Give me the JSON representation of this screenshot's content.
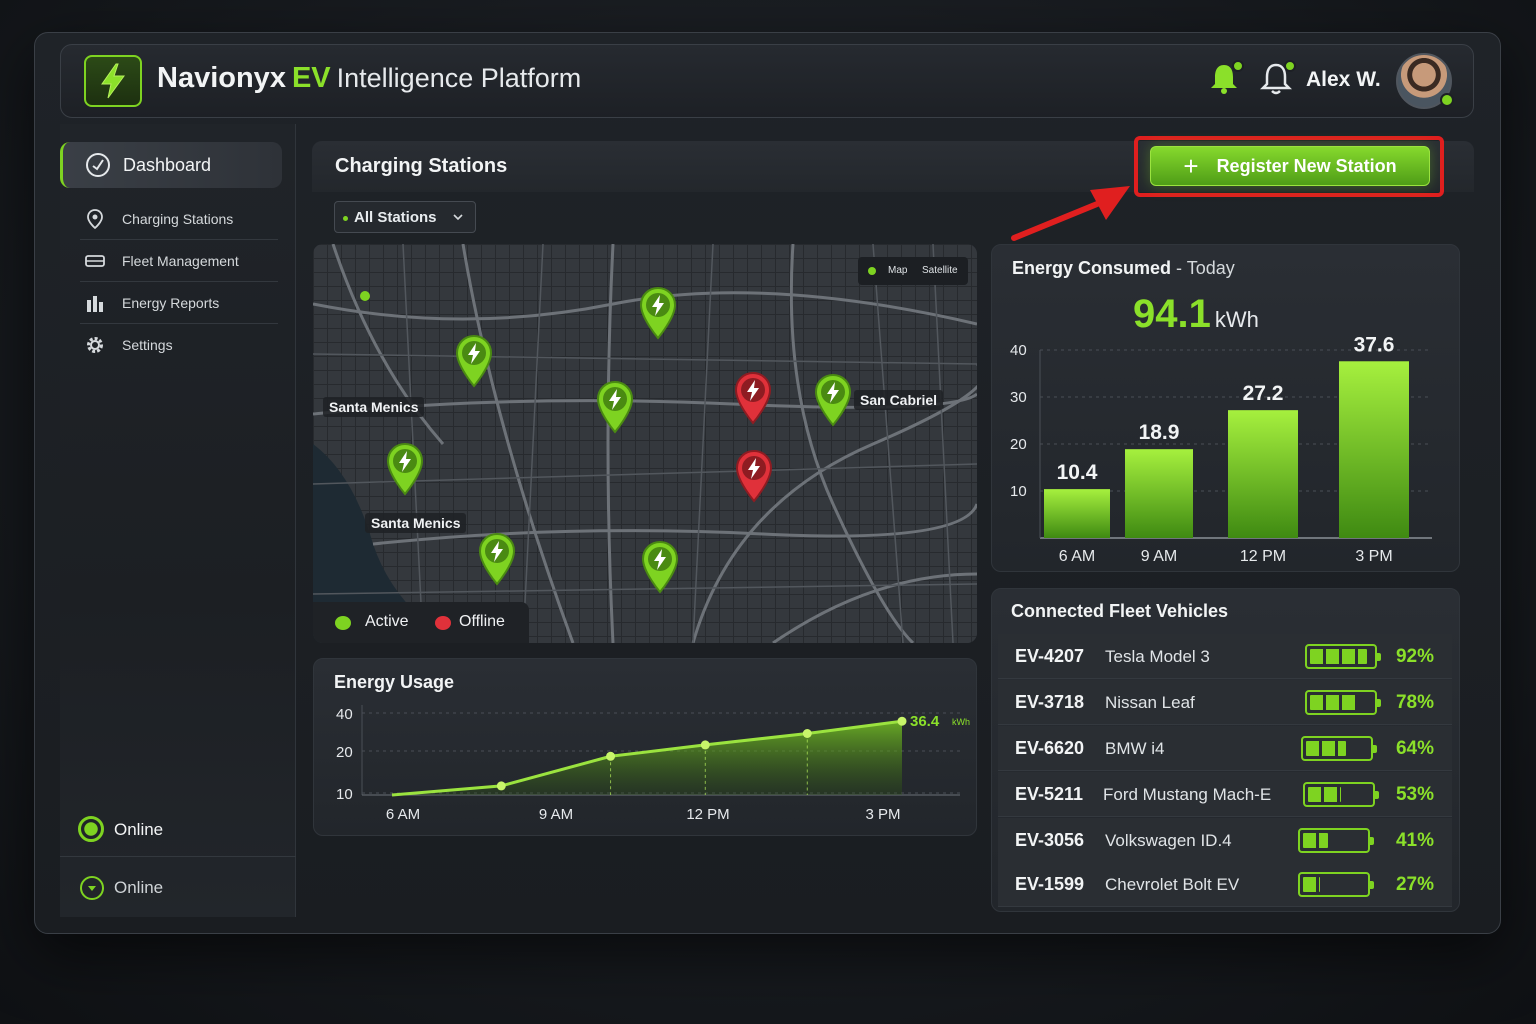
{
  "header": {
    "brand_name": "Navionyx",
    "brand_ev": "EV",
    "brand_suffix": "Intelligence Platform",
    "user_name": "Alex W."
  },
  "sidebar": {
    "items": [
      {
        "label": "Dashboard",
        "icon": "dashboard-icon",
        "active": true
      },
      {
        "label": "Charging Stations",
        "icon": "location-pin-icon"
      },
      {
        "label": "Fleet Management",
        "icon": "car-icon"
      },
      {
        "label": "Energy Reports",
        "icon": "bar-chart-icon"
      },
      {
        "label": "Settings",
        "icon": "gear-icon"
      }
    ],
    "status_primary": "Online",
    "status_secondary": "Online"
  },
  "main": {
    "title": "Charging Stations",
    "register_button": "Register New Station",
    "filter_value": "All Stations"
  },
  "map": {
    "toggle_map": "Map",
    "toggle_satellite": "Satellite",
    "labels": [
      "Santa Menics",
      "Santa Menics",
      "San Cabriel"
    ],
    "legend_active": "Active",
    "legend_offline": "Offline",
    "stations": {
      "active": 8,
      "offline": 2
    }
  },
  "energy_consumed": {
    "title": "Energy Consumed",
    "period": "- Today",
    "value": "94.1",
    "unit": "kWh"
  },
  "energy_usage": {
    "title": "Energy Usage",
    "end_label": "36.4",
    "end_unit": "kWh"
  },
  "fleet": {
    "title": "Connected Fleet Vehicles",
    "vehicles": [
      {
        "id": "EV-4207",
        "model": "Tesla Model 3",
        "charge": "92%",
        "level": 0.92
      },
      {
        "id": "EV-3718",
        "model": "Nissan Leaf",
        "charge": "78%",
        "level": 0.78
      },
      {
        "id": "EV-6620",
        "model": "BMW i4",
        "charge": "64%",
        "level": 0.64
      },
      {
        "id": "EV-5211",
        "model": "Ford Mustang Mach-E",
        "charge": "53%",
        "level": 0.53
      },
      {
        "id": "EV-3056",
        "model": "Volkswagen ID.4",
        "charge": "41%",
        "level": 0.41
      },
      {
        "id": "EV-1599",
        "model": "Chevrolet Bolt EV",
        "charge": "27%",
        "level": 0.27
      }
    ]
  },
  "colors": {
    "accent": "#7ed321",
    "alert": "#e01f1f",
    "offline": "#e0313a"
  },
  "chart_data": [
    {
      "type": "bar",
      "title": "Energy Consumed",
      "categories": [
        "6 AM",
        "9 AM",
        "12 PM",
        "3 PM"
      ],
      "values": [
        10.4,
        18.9,
        27.2,
        37.6
      ],
      "value_labels": [
        "10.4",
        "18.9",
        "27.2",
        "37.6"
      ],
      "y_ticks": [
        "10",
        "20",
        "30",
        "40"
      ],
      "ylim": [
        0,
        40
      ],
      "grid": true
    },
    {
      "type": "area",
      "title": "Energy Usage",
      "x_ticks": [
        "6 AM",
        "9 AM",
        "12 PM",
        "3 PM"
      ],
      "y_ticks": [
        "10",
        "20",
        "40"
      ],
      "x": [
        0,
        1.5,
        3,
        4.3,
        5.7,
        7
      ],
      "y": [
        4,
        8,
        21,
        26,
        31,
        36.4
      ],
      "grid": true
    }
  ]
}
